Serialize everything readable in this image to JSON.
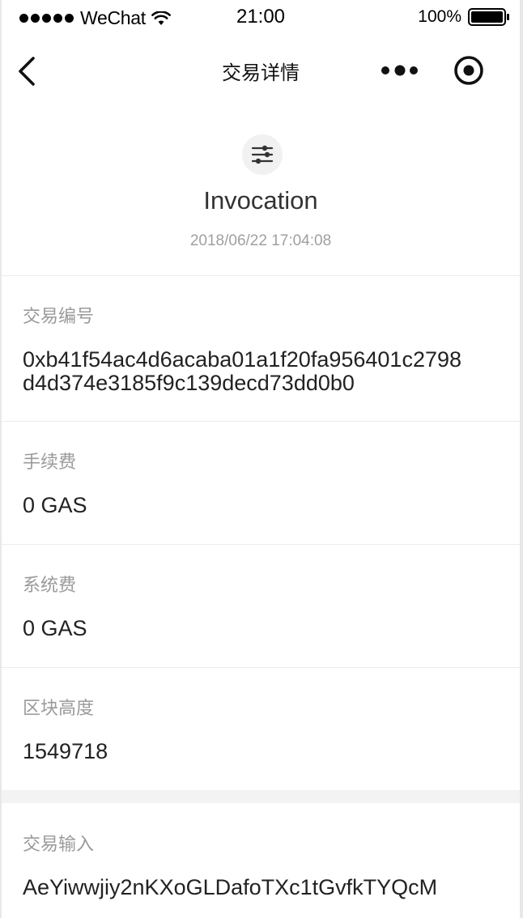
{
  "status_bar": {
    "carrier": "WeChat",
    "time": "21:00",
    "battery": "100%"
  },
  "nav": {
    "title": "交易详情"
  },
  "header": {
    "type": "Invocation",
    "time": "2018/06/22 17:04:08",
    "icon": "sliders-icon"
  },
  "details": {
    "txid_label": "交易编号",
    "txid_line1": "0xb41f54ac4d6acaba01a1f20fa956401c2798",
    "txid_line2": "d4d374e3185f9c139decd73dd0b0",
    "net_fee_label": "手续费",
    "net_fee_value": "0 GAS",
    "sys_fee_label": "系统费",
    "sys_fee_value": "0 GAS",
    "block_label": "区块高度",
    "block_value": "1549718"
  },
  "inputs": {
    "label": "交易输入",
    "address": "AeYiwwjiy2nKXoGLDafoTXc1tGvfkTYQcM"
  }
}
